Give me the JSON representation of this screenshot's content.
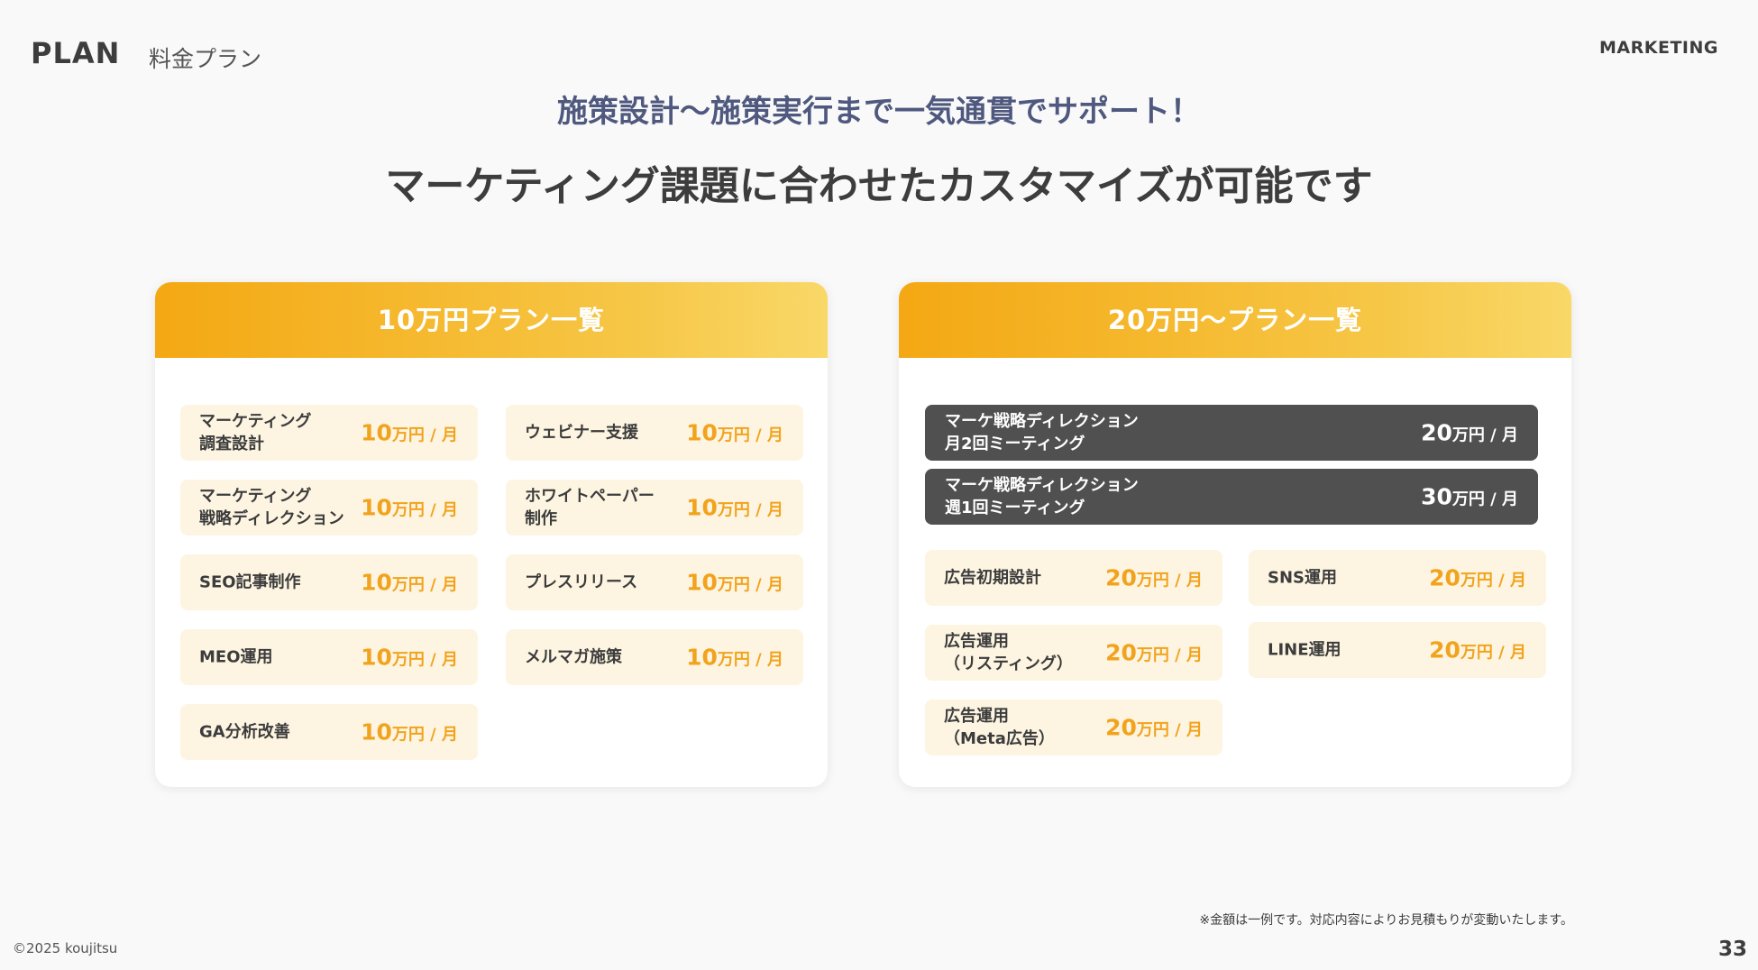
{
  "header": {
    "section": "PLAN",
    "subtitle": "料金プラン",
    "category": "MARKETING"
  },
  "catchphrase": "施策設計〜施策実行まで一気通貫でサポート！",
  "headline": "マーケティング課題に合わせたカスタマイズが可能です",
  "left_panel": {
    "title": "10万円プラン一覧",
    "items": [
      {
        "name": "マーケティング\n調査設計",
        "price": "10",
        "unit": "万円 / 月"
      },
      {
        "name": "ウェビナー支援",
        "price": "10",
        "unit": "万円 / 月"
      },
      {
        "name": "マーケティング\n戦略ディレクション",
        "price": "10",
        "unit": "万円 / 月"
      },
      {
        "name": "ホワイトペーパー\n制作",
        "price": "10",
        "unit": "万円 / 月"
      },
      {
        "name": "SEO記事制作",
        "price": "10",
        "unit": "万円 / 月"
      },
      {
        "name": "プレスリリース",
        "price": "10",
        "unit": "万円 / 月"
      },
      {
        "name": "MEO運用",
        "price": "10",
        "unit": "万円 / 月"
      },
      {
        "name": "メルマガ施策",
        "price": "10",
        "unit": "万円 / 月"
      },
      {
        "name": "GA分析改善",
        "price": "10",
        "unit": "万円 / 月"
      }
    ]
  },
  "right_panel": {
    "title": "20万円〜プラン一覧",
    "direction": [
      {
        "name": "マーケ戦略ディレクション\n月2回ミーティング",
        "price": "20",
        "unit": "万円 / 月"
      },
      {
        "name": "マーケ戦略ディレクション\n週1回ミーティング",
        "price": "30",
        "unit": "万円 / 月"
      }
    ],
    "items": [
      {
        "name": "広告初期設計",
        "price": "20",
        "unit": "万円 / 月"
      },
      {
        "name": "SNS運用",
        "price": "20",
        "unit": "万円 / 月"
      },
      {
        "name": "広告運用\n（リスティング）",
        "price": "20",
        "unit": "万円 / 月"
      },
      {
        "name": "LINE運用",
        "price": "20",
        "unit": "万円 / 月"
      },
      {
        "name": "広告運用\n（Meta広告）",
        "price": "20",
        "unit": "万円 / 月"
      }
    ]
  },
  "footer": {
    "note": "※金額は一例です。対応内容によりお見積もりが変動いたします。",
    "copyright": "©2025 koujitsu",
    "page": "33"
  },
  "colors": {
    "accent": "#f2a31d",
    "panel_head": "#f4a813",
    "item_bg": "#fdf5e2",
    "dark_item": "#505050",
    "catch": "#4f587e"
  }
}
